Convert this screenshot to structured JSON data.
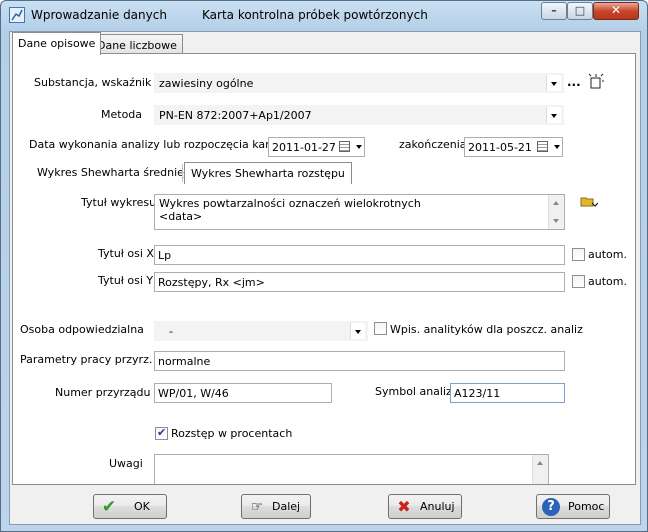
{
  "window": {
    "title": "Wprowadzanie danych",
    "subtitle": "Karta kontrolna próbek powtórzonych",
    "controls": {
      "minimize": "–",
      "maximize": "□",
      "close": "✕"
    }
  },
  "tabs": [
    {
      "label": "Dane opisowe",
      "active": true
    },
    {
      "label": "Dane liczbowe",
      "active": false
    }
  ],
  "form": {
    "substance_label": "Substancja, wskaźnik",
    "substance_value": "zawiesiny ogólne",
    "ellipsis": "...",
    "method_label": "Metoda",
    "method_value": "PN-EN 872:2007+Ap1/2007",
    "date_start_label": "Data wykonania analizy lub rozpoczęcia karty",
    "date_start_value": "2011-01-27",
    "date_end_label": "zakończenia",
    "date_end_value": "2011-05-21",
    "subtabs": [
      {
        "label": "Wykres Shewharta średniej",
        "active": false
      },
      {
        "label": "Wykres Shewharta rozstępu",
        "active": true
      }
    ],
    "chart_title_label": "Tytuł wykresu",
    "chart_title_lines": [
      "Wykres powtarzalności oznaczeń wielokrotnych",
      "<data>"
    ],
    "x_axis_label": "Tytuł osi X",
    "x_axis_value": "Lp",
    "x_auto_label": "autom.",
    "x_auto_checked": false,
    "y_axis_label": "Tytuł osi Y",
    "y_axis_value": "Rozstępy, Rx <jm>",
    "y_auto_label": "autom.",
    "y_auto_checked": false,
    "person_label": "Osoba odpowiedzialna",
    "person_value": "-",
    "per_analyst_label": "Wpis. analityków dla poszcz. analiz",
    "per_analyst_checked": false,
    "params_label": "Parametry pracy przyrz.",
    "params_value": "normalne",
    "device_label": "Numer przyrządu",
    "device_value": "WP/01, W/46",
    "symbol_label": "Symbol analizy",
    "symbol_value": "A123/11",
    "percent_label": "Rozstęp w procentach",
    "percent_checked": true,
    "notes_label": "Uwagi",
    "notes_value": ""
  },
  "buttons": {
    "ok": "OK",
    "next": "Dalej",
    "cancel": "Anuluj",
    "help": "Pomoc"
  },
  "colors": {
    "ok_icon": "#2f9a25",
    "cancel_icon": "#c8241b",
    "help_icon": "#2a63b8",
    "folder_icon": "#e1b82c"
  }
}
